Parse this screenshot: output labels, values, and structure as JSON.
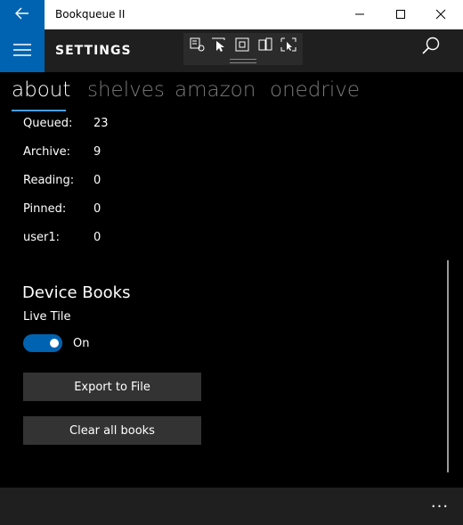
{
  "window": {
    "title": "Bookqueue II"
  },
  "header": {
    "page_title": "SETTINGS"
  },
  "pivot": {
    "items": [
      "about",
      "shelves",
      "amazon",
      "onedrive"
    ],
    "active": "about"
  },
  "stats": [
    {
      "label": "Queued:",
      "value": "23"
    },
    {
      "label": "Archive:",
      "value": "9"
    },
    {
      "label": "Reading:",
      "value": "0"
    },
    {
      "label": "Pinned:",
      "value": "0"
    },
    {
      "label": "user1:",
      "value": "0"
    }
  ],
  "device_books": {
    "title": "Device Books",
    "live_tile_label": "Live Tile",
    "toggle_state": "On"
  },
  "buttons": {
    "export": "Export to File",
    "clear": "Clear all books"
  },
  "bottombar": {
    "more": "..."
  },
  "colors": {
    "accent": "#0063b1",
    "pivot_underline": "#4a9de8",
    "inactive_text": "#7a7a7a",
    "bar_background": "#1f1f1f",
    "button_background": "#333333"
  },
  "icons": {
    "back": "back-arrow-icon",
    "menu": "hamburger-menu-icon",
    "search": "search-icon",
    "minimize": "minimize-icon",
    "maximize": "maximize-icon",
    "close": "close-icon"
  }
}
